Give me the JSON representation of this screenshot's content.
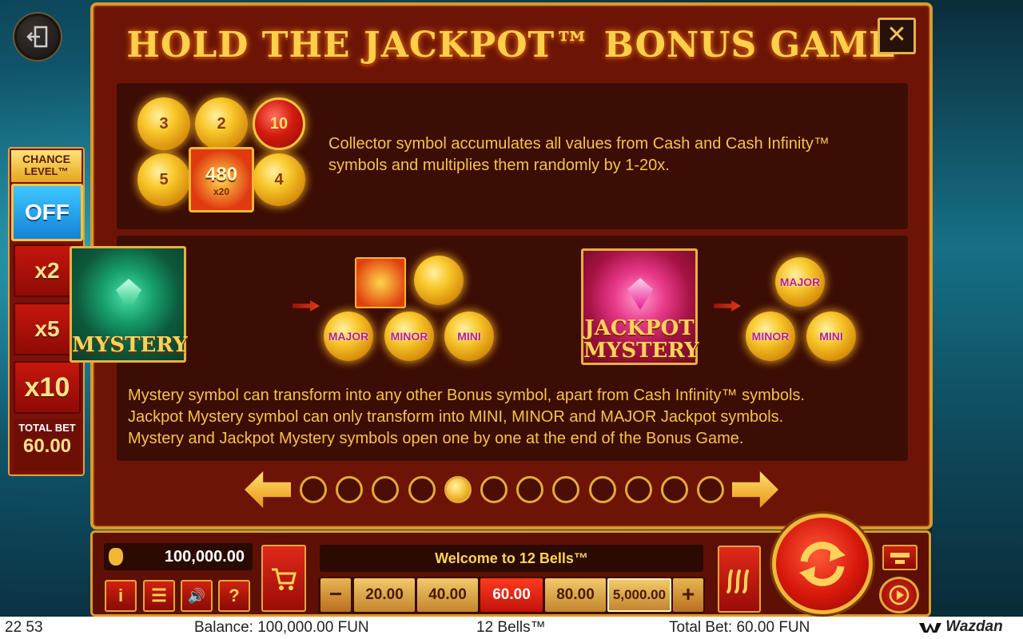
{
  "panel": {
    "title": "HOLD THE JACKPOT™ BONUS GAME",
    "close_label": "✕"
  },
  "collector": {
    "coins": [
      "3",
      "2",
      "10",
      "5",
      "4"
    ],
    "center_value": "480",
    "multiplier": "x20",
    "description_line1": "Collector symbol accumulates all values from Cash and Cash Infinity™",
    "description_line2": "symbols and multiplies them randomly by 1-20x."
  },
  "mystery": {
    "symbol_label": "MYSTERY",
    "jackpot_symbol_line1": "JACKPOT",
    "jackpot_symbol_line2": "MYSTERY",
    "coin_major": "MAJOR",
    "coin_minor": "MINOR",
    "coin_mini": "MINI",
    "description_line1": "Mystery symbol can transform into any other Bonus symbol, apart from Cash Infinity™ symbols.",
    "description_line2": "Jackpot Mystery symbol can only transform into MINI, MINOR and MAJOR Jackpot symbols.",
    "description_line3": "Mystery and Jackpot Mystery symbols open one by one at the end of the Bonus Game."
  },
  "pagination": {
    "total_pages": 12,
    "active_page": 5
  },
  "chance_level": {
    "title_line1": "CHANCE",
    "title_line2": "LEVEL™",
    "options": [
      "OFF",
      "x2",
      "x5",
      "x10"
    ],
    "selected": "OFF",
    "total_bet_label": "TOTAL BET",
    "total_bet_value": "60.00"
  },
  "controls": {
    "balance": "100,000.00",
    "welcome_message": "Welcome to 12 Bells™",
    "minus_label": "−",
    "plus_label": "+",
    "bets": [
      "20.00",
      "40.00",
      "60.00",
      "80.00",
      "5,000.00"
    ],
    "selected_bet": "60.00",
    "info_label": "i",
    "menu_label": "☰",
    "sound_label": "🔊",
    "help_label": "?"
  },
  "status_bar": {
    "time": "22 53",
    "balance_text": "Balance: 100,000.00 FUN",
    "game_name": "12 Bells™",
    "total_bet_text": "Total Bet: 60.00 FUN",
    "brand": "Wazdan"
  },
  "colors": {
    "panel_bg": "#6d1406",
    "panel_border": "#d89b2a",
    "text_gold": "#f3c44a",
    "selected_red": "#ff3a1e",
    "off_blue": "#1482d6"
  }
}
